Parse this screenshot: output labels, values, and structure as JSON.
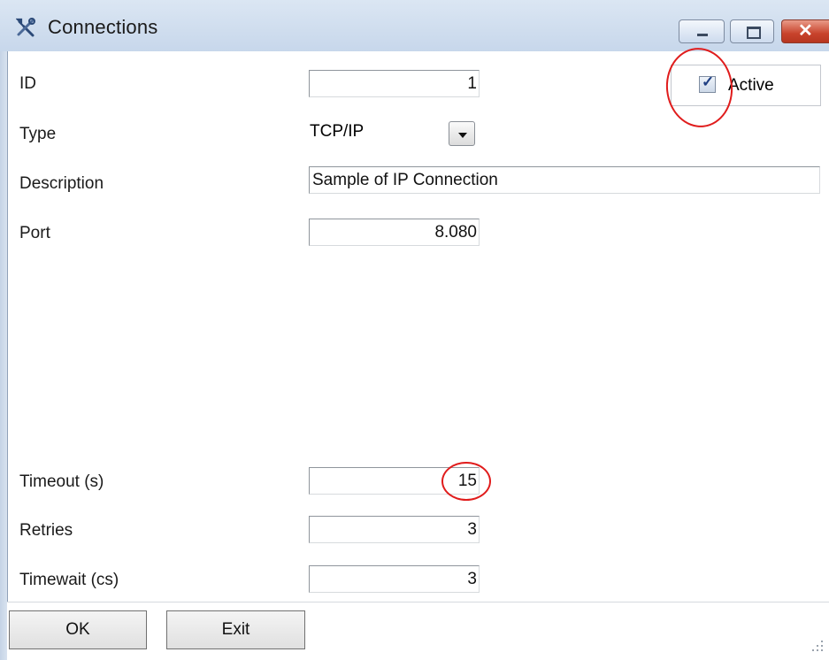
{
  "window": {
    "title": "Connections"
  },
  "form": {
    "id_label": "ID",
    "id_value": "1",
    "type_label": "Type",
    "type_value": "TCP/IP",
    "description_label": "Description",
    "description_value": "Sample of IP Connection",
    "port_label": "Port",
    "port_value": "8.080",
    "timeout_label": "Timeout (s)",
    "timeout_value": "15",
    "retries_label": "Retries",
    "retries_value": "3",
    "timewait_label": "Timewait (cs)",
    "timewait_value": "3",
    "active_label": "Active",
    "active_checked": true
  },
  "buttons": {
    "ok": "OK",
    "exit": "Exit"
  },
  "icons": {
    "title": "tools-icon",
    "minimize": "minimize-icon",
    "maximize": "maximize-icon",
    "close": "close-icon"
  },
  "colors": {
    "annotation": "#e01c1c",
    "titlebar": "#d2dff0",
    "close_button": "#c8432c"
  }
}
